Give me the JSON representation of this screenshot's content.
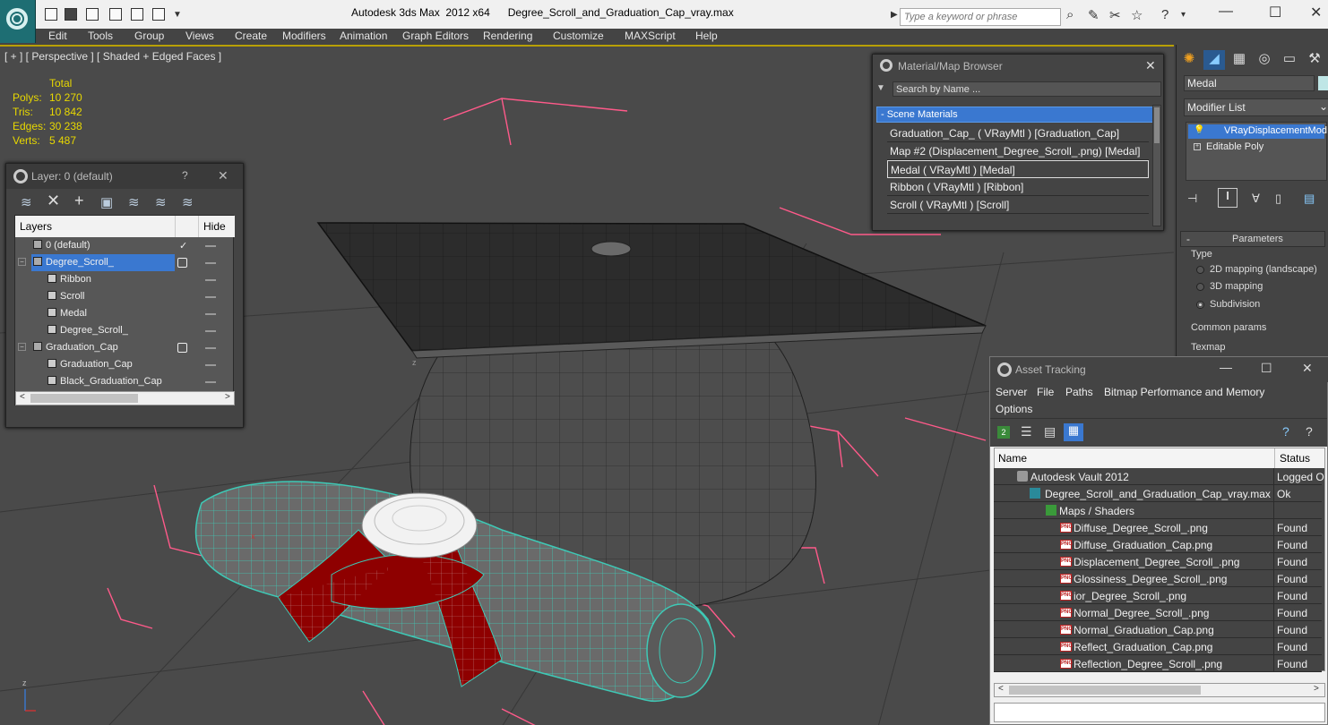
{
  "window": {
    "title": "Autodesk 3ds Max  2012 x64      Degree_Scroll_and_Graduation_Cap_vray.max",
    "search_placeholder": "Type a keyword or phrase"
  },
  "menu": [
    "Edit",
    "Tools",
    "Group",
    "Views",
    "Create",
    "Modifiers",
    "Animation",
    "Graph Editors",
    "Rendering",
    "Customize",
    "MAXScript",
    "Help"
  ],
  "viewport": {
    "label": "[ + ] [ Perspective ] [ Shaded + Edged Faces ]",
    "stats_header": "Total",
    "stats": [
      {
        "label": "Polys:",
        "value": "10 270"
      },
      {
        "label": "Tris:",
        "value": "10 842"
      },
      {
        "label": "Edges:",
        "value": "30 238"
      },
      {
        "label": "Verts:",
        "value": "5 487"
      }
    ],
    "axis_z": "z",
    "axis_x": "x"
  },
  "layer_dialog": {
    "title": "Layer: 0 (default)",
    "help": "?",
    "close": "✕",
    "col_layers": "Layers",
    "col_hide": "Hide",
    "rows": [
      {
        "name": "0 (default)",
        "indent": 0,
        "check": "✓"
      },
      {
        "name": "Degree_Scroll_",
        "indent": 0,
        "selected": true
      },
      {
        "name": "Ribbon",
        "indent": 1
      },
      {
        "name": "Scroll",
        "indent": 1
      },
      {
        "name": "Medal",
        "indent": 1
      },
      {
        "name": "Degree_Scroll_",
        "indent": 1
      },
      {
        "name": "Graduation_Cap",
        "indent": 0
      },
      {
        "name": "Graduation_Cap",
        "indent": 1
      },
      {
        "name": "Black_Graduation_Cap",
        "indent": 1
      }
    ]
  },
  "material_browser": {
    "title": "Material/Map Browser",
    "search_placeholder": "Search by Name ...",
    "section": "- Scene Materials",
    "items": [
      "Graduation_Cap_  ( VRayMtl ) [Graduation_Cap]",
      "Map #2 (Displacement_Degree_Scroll_.png) [Medal]",
      "Medal  ( VRayMtl ) [Medal]",
      "Ribbon  ( VRayMtl ) [Ribbon]",
      "Scroll  ( VRayMtl ) [Scroll]"
    ],
    "selected_index": 2
  },
  "command_panel": {
    "object_name": "Medal",
    "modifier_list": "Modifier List",
    "stack": [
      "VRayDisplacementMod",
      "Editable Poly"
    ],
    "parameters": "Parameters",
    "type_label": "Type",
    "type_options": [
      "2D mapping (landscape)",
      "3D mapping",
      "Subdivision"
    ],
    "type_selected": 2,
    "common_params": "Common params",
    "texmap": "Texmap"
  },
  "asset_tracking": {
    "title": "Asset Tracking",
    "menu": [
      "Server",
      "File",
      "Paths",
      "Bitmap Performance and Memory",
      "Options"
    ],
    "col_name": "Name",
    "col_status": "Status",
    "rows": [
      {
        "name": "Autodesk Vault 2012",
        "status": "Logged O",
        "indent": 1,
        "icon": "vault"
      },
      {
        "name": "Degree_Scroll_and_Graduation_Cap_vray.max",
        "status": "Ok",
        "indent": 2,
        "icon": "max"
      },
      {
        "name": "Maps / Shaders",
        "status": "",
        "indent": 3,
        "icon": "maps"
      },
      {
        "name": "Diffuse_Degree_Scroll_.png",
        "status": "Found",
        "indent": 4,
        "icon": "png"
      },
      {
        "name": "Diffuse_Graduation_Cap.png",
        "status": "Found",
        "indent": 4,
        "icon": "png"
      },
      {
        "name": "Displacement_Degree_Scroll_.png",
        "status": "Found",
        "indent": 4,
        "icon": "png"
      },
      {
        "name": "Glossiness_Degree_Scroll_.png",
        "status": "Found",
        "indent": 4,
        "icon": "png"
      },
      {
        "name": "ior_Degree_Scroll_.png",
        "status": "Found",
        "indent": 4,
        "icon": "png"
      },
      {
        "name": "Normal_Degree_Scroll_.png",
        "status": "Found",
        "indent": 4,
        "icon": "png"
      },
      {
        "name": "Normal_Graduation_Cap.png",
        "status": "Found",
        "indent": 4,
        "icon": "png"
      },
      {
        "name": "Reflect_Graduation_Cap.png",
        "status": "Found",
        "indent": 4,
        "icon": "png"
      },
      {
        "name": "Reflection_Degree_Scroll_.png",
        "status": "Found",
        "indent": 4,
        "icon": "png"
      }
    ]
  },
  "colors": {
    "accent": "#3a78d0",
    "stats": "#e8d800",
    "wire_teal": "#3ec9b6",
    "ribbon_red": "#8e0000",
    "bbox_pink": "#ff5a8a"
  }
}
